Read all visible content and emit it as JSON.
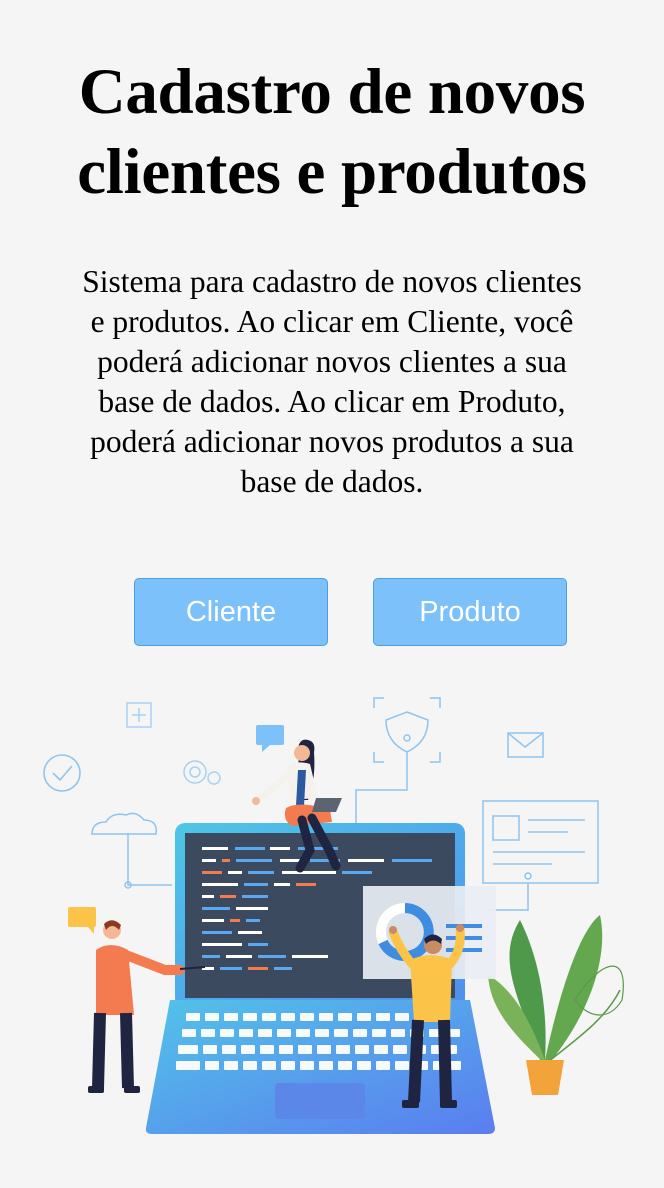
{
  "header": {
    "title_line1": "Cadastro de novos",
    "title_line2": "clientes e produtos"
  },
  "intro": {
    "line1": "Sistema para cadastro de novos clientes",
    "line2": "e produtos. Ao clicar em Cliente, você",
    "line3": "poderá adicionar novos clientes a sua",
    "line4": "base de dados. Ao clicar em Produto,",
    "line5": "poderá adicionar novos produtos a sua",
    "line6": "base de dados."
  },
  "actions": {
    "cliente_label": "Cliente",
    "produto_label": "Produto"
  },
  "illustration": {
    "icon": "developers-laptop-illustration",
    "colors": {
      "button": "#7cc1f9",
      "button_border": "#4a9fe6",
      "laptop_screen": "#3b4a5e",
      "laptop_body": "#5aa9f0",
      "accent_orange": "#f47a50",
      "accent_yellow": "#fbc448",
      "plant_green": "#4e9a4a"
    }
  }
}
